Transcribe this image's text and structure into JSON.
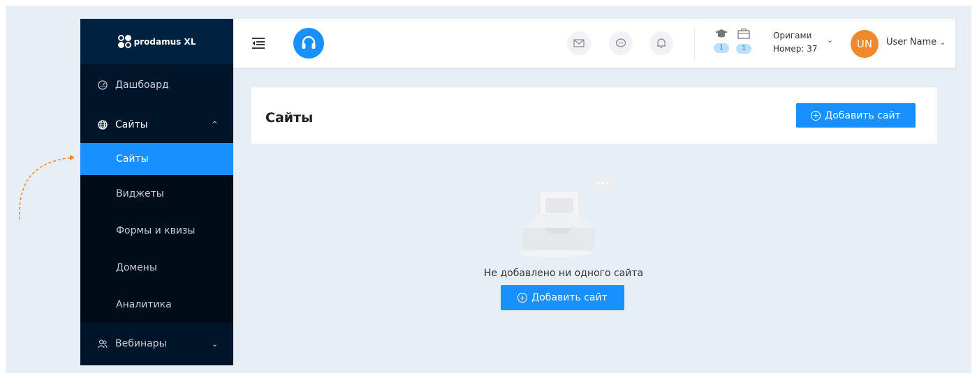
{
  "brand": {
    "logo_text": "prodamus XL"
  },
  "sidebar": {
    "dashboard_label": "Дашбоард",
    "sites_group_label": "Сайты",
    "sites_submenu": [
      {
        "label": "Сайты",
        "active": true
      },
      {
        "label": "Виджеты",
        "active": false
      },
      {
        "label": "Формы и квизы",
        "active": false
      },
      {
        "label": "Домены",
        "active": false
      },
      {
        "label": "Аналитика",
        "active": false
      }
    ],
    "webinars_label": "Вебинары"
  },
  "header": {
    "courses_count": "1",
    "projects_count": "1",
    "org_name": "Оригами",
    "org_number": "Номер: 37",
    "avatar_initials": "UN",
    "user_name": "User Name"
  },
  "main": {
    "page_title": "Сайты",
    "add_site_button": "Добавить сайт",
    "empty_text": "Не добавлено ни одного сайта",
    "empty_add_button": "Добавить сайт"
  },
  "colors": {
    "accent": "#1890ff",
    "sidebar_bg": "#001529",
    "avatar_bg": "#f0882c",
    "page_bg": "#e8eef6"
  }
}
